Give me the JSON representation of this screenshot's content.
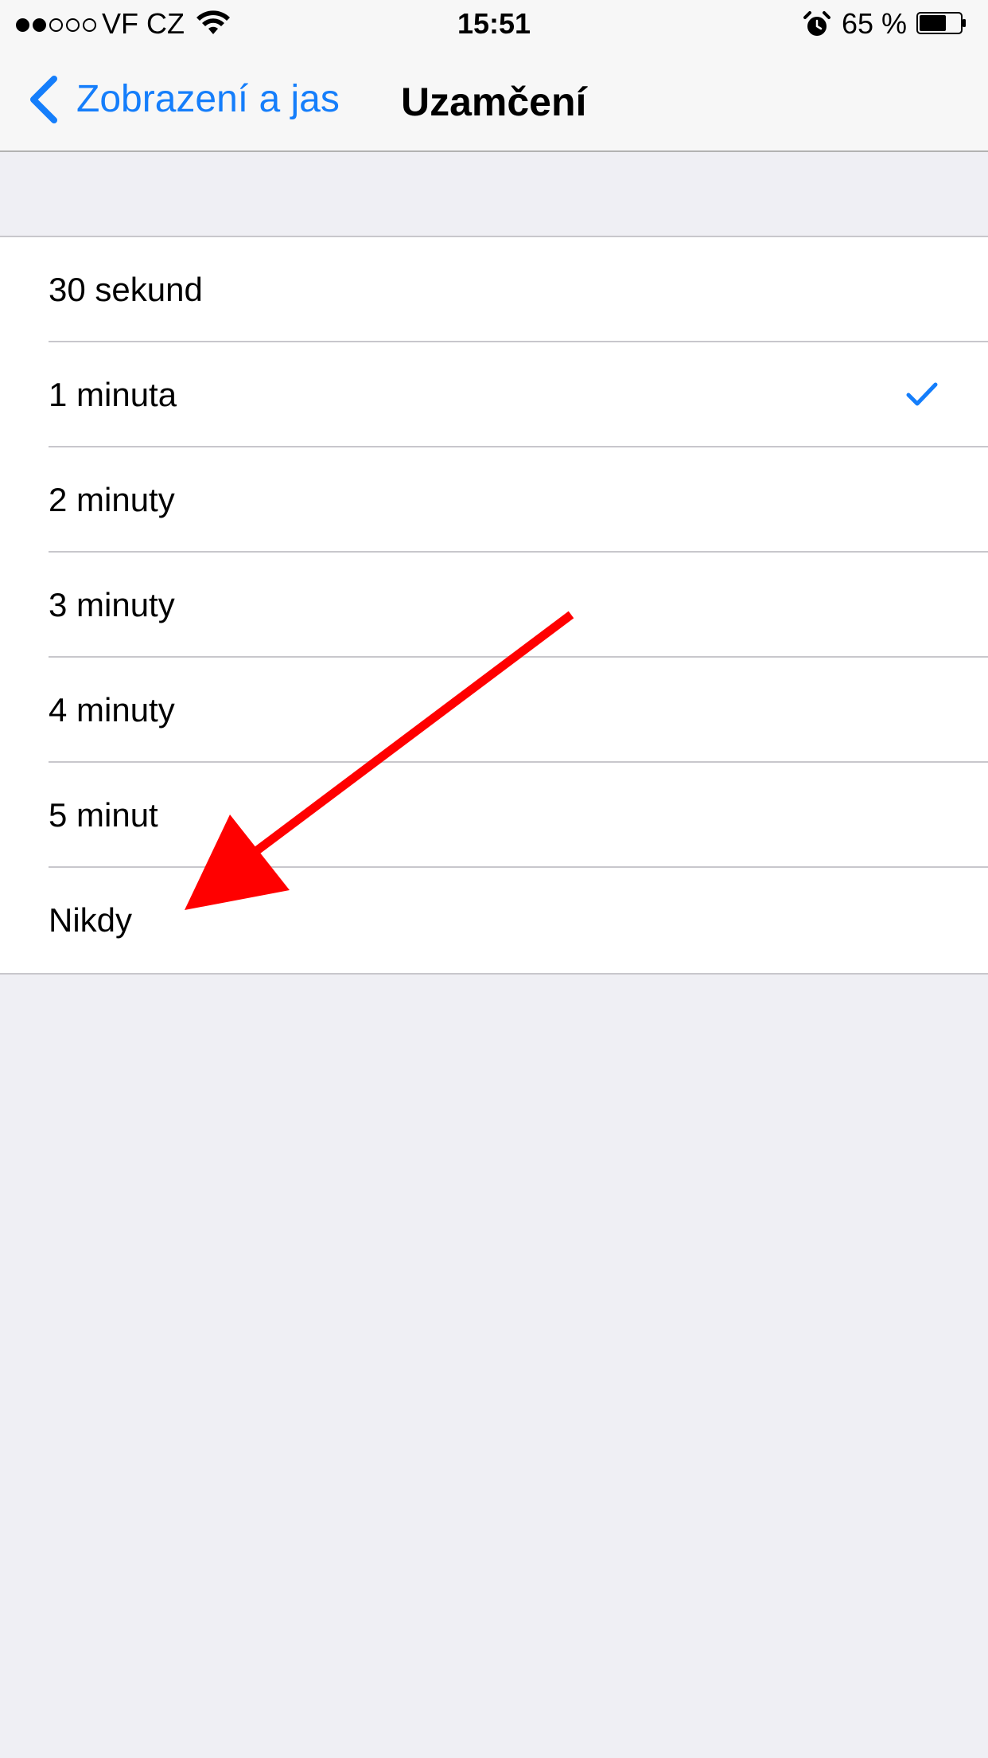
{
  "status_bar": {
    "signal_filled": 2,
    "signal_total": 5,
    "carrier": "VF CZ",
    "time": "15:51",
    "battery_percent": "65 %",
    "battery_level": 0.65
  },
  "nav": {
    "back_label": "Zobrazení a jas",
    "title": "Uzamčení"
  },
  "options": [
    {
      "label": "30 sekund",
      "selected": false
    },
    {
      "label": "1 minuta",
      "selected": true
    },
    {
      "label": "2 minuty",
      "selected": false
    },
    {
      "label": "3 minuty",
      "selected": false
    },
    {
      "label": "4 minuty",
      "selected": false
    },
    {
      "label": "5 minut",
      "selected": false
    },
    {
      "label": "Nikdy",
      "selected": false
    }
  ],
  "colors": {
    "accent": "#157efb",
    "annotation": "#ff0000",
    "background": "#efeff4"
  },
  "icons": {
    "back": "chevron-left-icon",
    "checkmark": "checkmark-icon",
    "alarm": "alarm-clock-icon",
    "wifi": "wifi-icon",
    "battery": "battery-icon",
    "arrow": "red-arrow-annotation"
  }
}
